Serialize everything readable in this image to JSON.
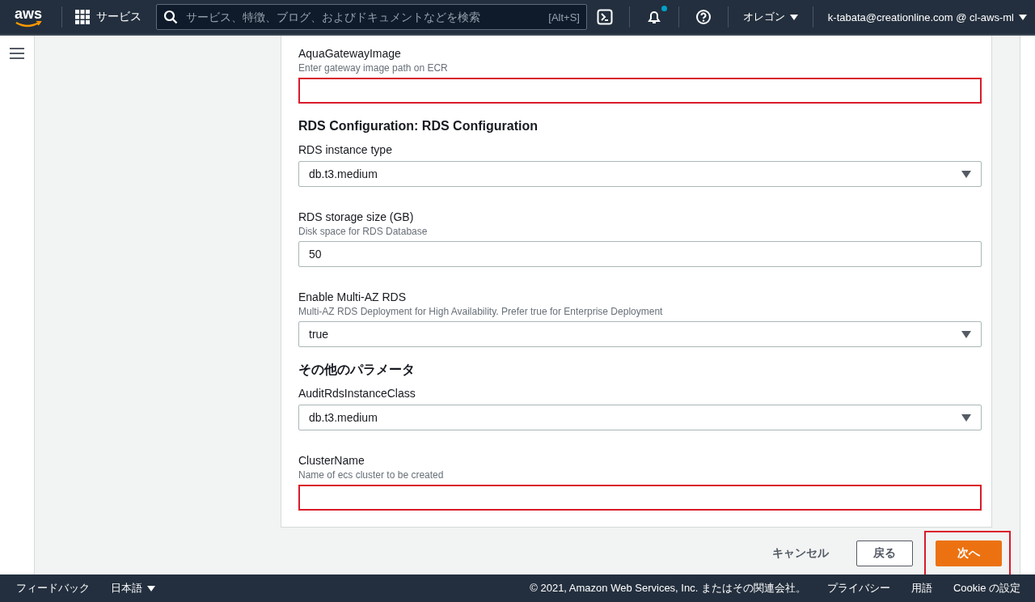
{
  "header": {
    "logo": "aws",
    "services": "サービス",
    "search": {
      "placeholder": "サービス、特徴、ブログ、およびドキュメントなどを検索",
      "shortcut": "[Alt+S]"
    },
    "notification_dot": true,
    "region": "オレゴン",
    "account": "k-tabata@creationline.com @ cl-aws-ml"
  },
  "form": [
    {
      "kind": "text_field",
      "label": "AquaGatewayImage",
      "description": "Enter gateway image path on ECR",
      "highlighted": true
    },
    {
      "kind": "heading",
      "text": "RDS Configuration: RDS Configuration"
    },
    {
      "kind": "select_field",
      "label": "RDS instance type",
      "value": "db.t3.medium",
      "highlighted": false
    },
    {
      "kind": "text_field",
      "label": "RDS storage size (GB)",
      "description": "Disk space for RDS Database",
      "value": "50",
      "highlighted": false
    },
    {
      "kind": "select_field",
      "label": "Enable Multi-AZ RDS",
      "description": "Multi-AZ RDS Deployment for High Availability. Prefer true for Enterprise Deployment",
      "value": "true",
      "highlighted": false
    },
    {
      "kind": "heading",
      "text": "その他のパラメータ"
    },
    {
      "kind": "select_field",
      "label": "AuditRdsInstanceClass",
      "value": "db.t3.medium",
      "highlighted": false
    },
    {
      "kind": "text_field",
      "label": "ClusterName",
      "description": "Name of ecs cluster to be created",
      "highlighted": true
    }
  ],
  "actions": [
    {
      "kind": "link",
      "label": "キャンセル",
      "highlighted": false
    },
    {
      "kind": "secondary",
      "label": "戻る",
      "highlighted": false
    },
    {
      "kind": "primary",
      "label": "次へ",
      "highlighted": true
    }
  ],
  "footer": {
    "left": [
      {
        "label": "フィードバック",
        "dropdown": false
      },
      {
        "label": "日本語",
        "dropdown": true
      }
    ],
    "copyright": "© 2021, Amazon Web Services, Inc. またはその関連会社。",
    "links": [
      "プライバシー",
      "用語",
      "Cookie の設定"
    ]
  }
}
